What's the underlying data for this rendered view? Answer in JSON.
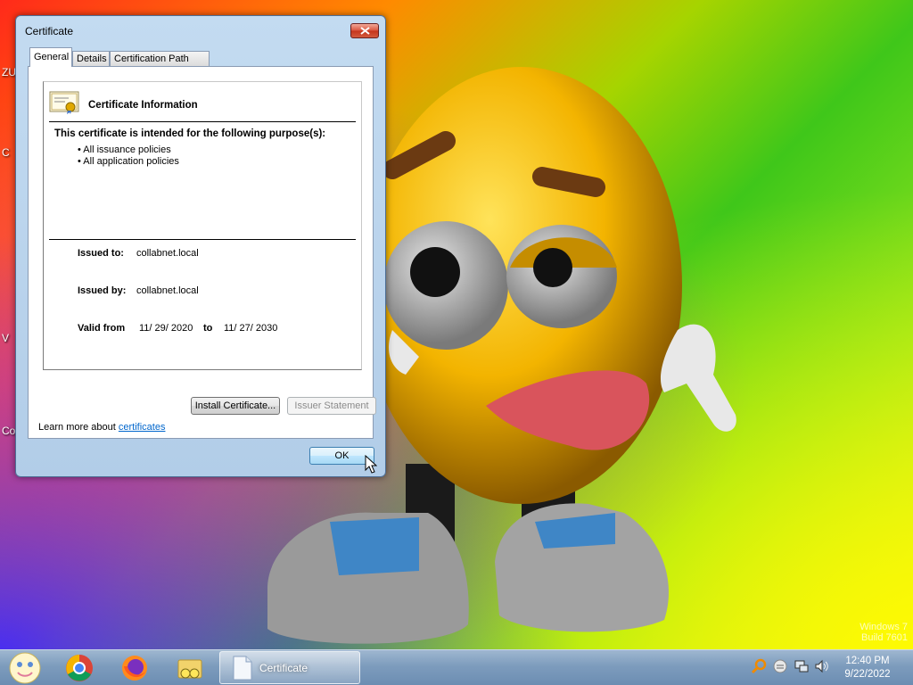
{
  "desktop": {
    "left_fragments": [
      "ZU",
      "C",
      "V",
      "Co"
    ],
    "watermark": [
      "Windows 7",
      "Build 7601"
    ]
  },
  "dialog": {
    "title": "Certificate",
    "tabs": [
      {
        "label": "General",
        "active": true
      },
      {
        "label": "Details",
        "active": false
      },
      {
        "label": "Certification Path",
        "active": false
      }
    ],
    "info_title": "Certificate Information",
    "purpose_heading": "This certificate is intended for the following purpose(s):",
    "purposes": [
      "• All issuance policies",
      "• All application policies"
    ],
    "issued_to_label": "Issued to:",
    "issued_to": "collabnet.local",
    "issued_by_label": "Issued by:",
    "issued_by": "collabnet.local",
    "valid_from_label": "Valid from",
    "valid_from": "11/ 29/ 2020",
    "valid_to_label": "to",
    "valid_to": "11/ 27/ 2030",
    "install_button": "Install Certificate...",
    "issuer_button": "Issuer Statement",
    "learn_prefix": "Learn more about ",
    "learn_link": "certificates",
    "ok_button": "OK"
  },
  "taskbar": {
    "task_label": "Certificate",
    "time": "12:40 PM",
    "date": "9/22/2022"
  }
}
